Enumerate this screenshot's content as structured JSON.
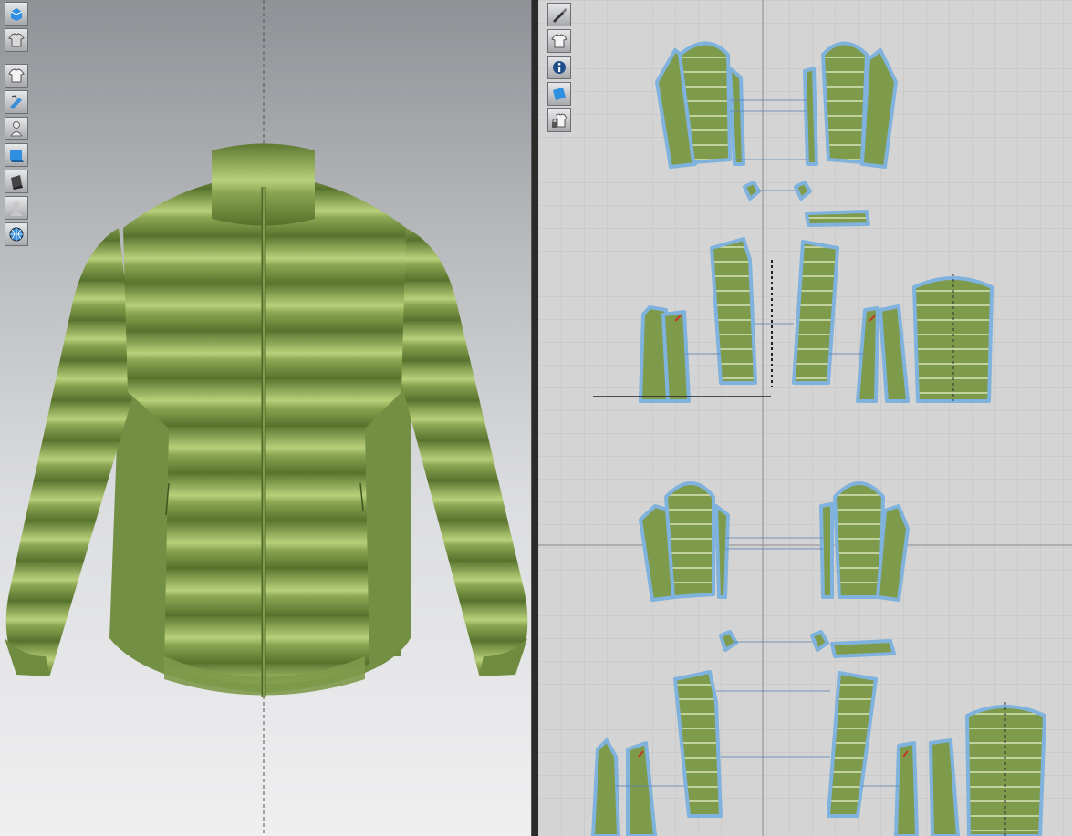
{
  "app": {
    "views": [
      "3d-garment-view",
      "2d-pattern-view"
    ],
    "colors": {
      "fabric": "#7e9a4b",
      "fabric_dark": "#5f7a34",
      "fabric_shine": "#c9dc8e",
      "outline": "#7fb2dd",
      "grid_bg": "#d4d4d4",
      "grid_line": "#c4c4c4"
    }
  },
  "toolbar_3d": {
    "items": [
      {
        "name": "3d-avatar-display-icon"
      },
      {
        "name": "garment-display-icon"
      },
      {
        "name": "show-garment-icon"
      },
      {
        "name": "show-pattern-icon"
      },
      {
        "name": "show-avatar-icon"
      },
      {
        "name": "texture-display-icon"
      },
      {
        "name": "render-mode-icon"
      },
      {
        "name": "avatar-silhouette-icon"
      },
      {
        "name": "environment-globe-icon"
      }
    ]
  },
  "toolbar_2d": {
    "items": [
      {
        "name": "pen-tool-icon"
      },
      {
        "name": "show-2d-garment-icon"
      },
      {
        "name": "info-icon"
      },
      {
        "name": "texture-2d-icon"
      },
      {
        "name": "lock-garment-icon"
      }
    ]
  }
}
